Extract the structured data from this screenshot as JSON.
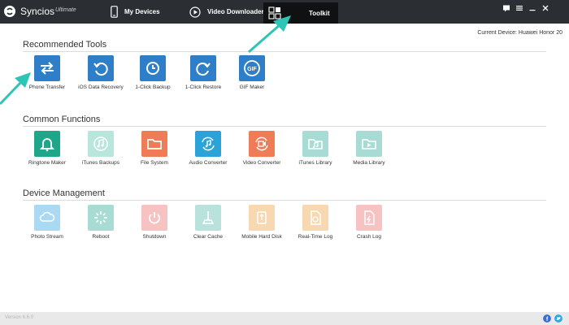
{
  "app": {
    "name": "Syncios",
    "edition": "Ultimate"
  },
  "nav": {
    "my_devices": "My Devices",
    "video_downloader": "Video Downloader",
    "toolkit": "Toolkit"
  },
  "window_controls": [
    "message-icon",
    "menu-icon",
    "minimize-icon",
    "close-icon"
  ],
  "current_device": "Current Device: Huawei Honor 20",
  "sections": {
    "recommended": {
      "title": "Recommended Tools",
      "tools": [
        {
          "label": "Phone Transfer",
          "icon": "phone-transfer-icon",
          "color": "#2f7fc8"
        },
        {
          "label": "iOS Data Recovery",
          "icon": "data-recovery-icon",
          "color": "#2f7fc8"
        },
        {
          "label": "1-Click Backup",
          "icon": "backup-icon",
          "color": "#2f7fc8"
        },
        {
          "label": "1-Click Restore",
          "icon": "restore-icon",
          "color": "#2f7fc8"
        },
        {
          "label": "GIF Maker",
          "icon": "gif-icon",
          "color": "#2f7fc8"
        }
      ]
    },
    "common": {
      "title": "Common Functions",
      "tools": [
        {
          "label": "Ringtone Maker",
          "icon": "bell-icon",
          "color": "#1fa68a"
        },
        {
          "label": "iTunes Backups",
          "icon": "music-note-icon",
          "color": "#b8e6dc"
        },
        {
          "label": "File System",
          "icon": "folder-icon",
          "color": "#f07b57"
        },
        {
          "label": "Audio Converter",
          "icon": "audio-convert-icon",
          "color": "#2aa3d8"
        },
        {
          "label": "Video Converter",
          "icon": "video-convert-icon",
          "color": "#f07b57"
        },
        {
          "label": "iTunes Library",
          "icon": "music-folder-icon",
          "color": "#a8dbd3"
        },
        {
          "label": "Media Library",
          "icon": "media-folder-icon",
          "color": "#a8dbd3"
        }
      ]
    },
    "device": {
      "title": "Device Management",
      "tools": [
        {
          "label": "Photo Stream",
          "icon": "cloud-icon",
          "color": "#a9d9f3"
        },
        {
          "label": "Reboot",
          "icon": "reboot-icon",
          "color": "#a8dbd3"
        },
        {
          "label": "Shutdown",
          "icon": "power-icon",
          "color": "#f6c2c2"
        },
        {
          "label": "Clear Cache",
          "icon": "broom-icon",
          "color": "#b9e2dc"
        },
        {
          "label": "Mobile Hard Disk",
          "icon": "usb-icon",
          "color": "#f8d8b0"
        },
        {
          "label": "Real-Time Log",
          "icon": "log-icon",
          "color": "#f8d8b0"
        },
        {
          "label": "Crash Log",
          "icon": "crash-log-icon",
          "color": "#f6c2c2"
        }
      ]
    }
  },
  "status": {
    "version": "Version 6.6.0"
  },
  "social": [
    "facebook-icon",
    "twitter-icon"
  ],
  "colors": {
    "topbar": "#2b2f33",
    "toolkit_tab": "#0f1113",
    "arrow": "#2ec4b6"
  }
}
